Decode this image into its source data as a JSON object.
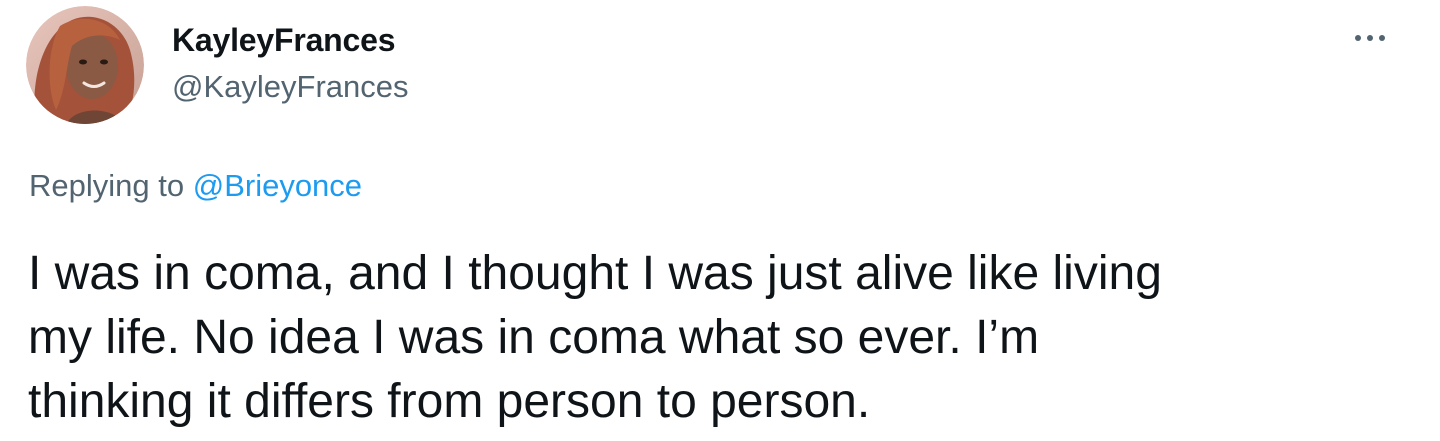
{
  "author": {
    "display_name": "KayleyFrances",
    "handle": "@KayleyFrances",
    "avatar_icon": "profile-photo"
  },
  "menu": {
    "icon": "more-horizontal-icon"
  },
  "reply": {
    "prefix": "Replying to ",
    "to_handle": "@Brieyonce"
  },
  "tweet": {
    "text_lines": [
      "I was in coma, and I thought I was just alive like living",
      "my life. No idea I was in coma what so ever. I’m",
      "thinking it differs from person to person."
    ]
  },
  "colors": {
    "text_primary": "#0f1419",
    "text_secondary": "#536471",
    "link": "#1d9bf0",
    "background": "#ffffff"
  }
}
